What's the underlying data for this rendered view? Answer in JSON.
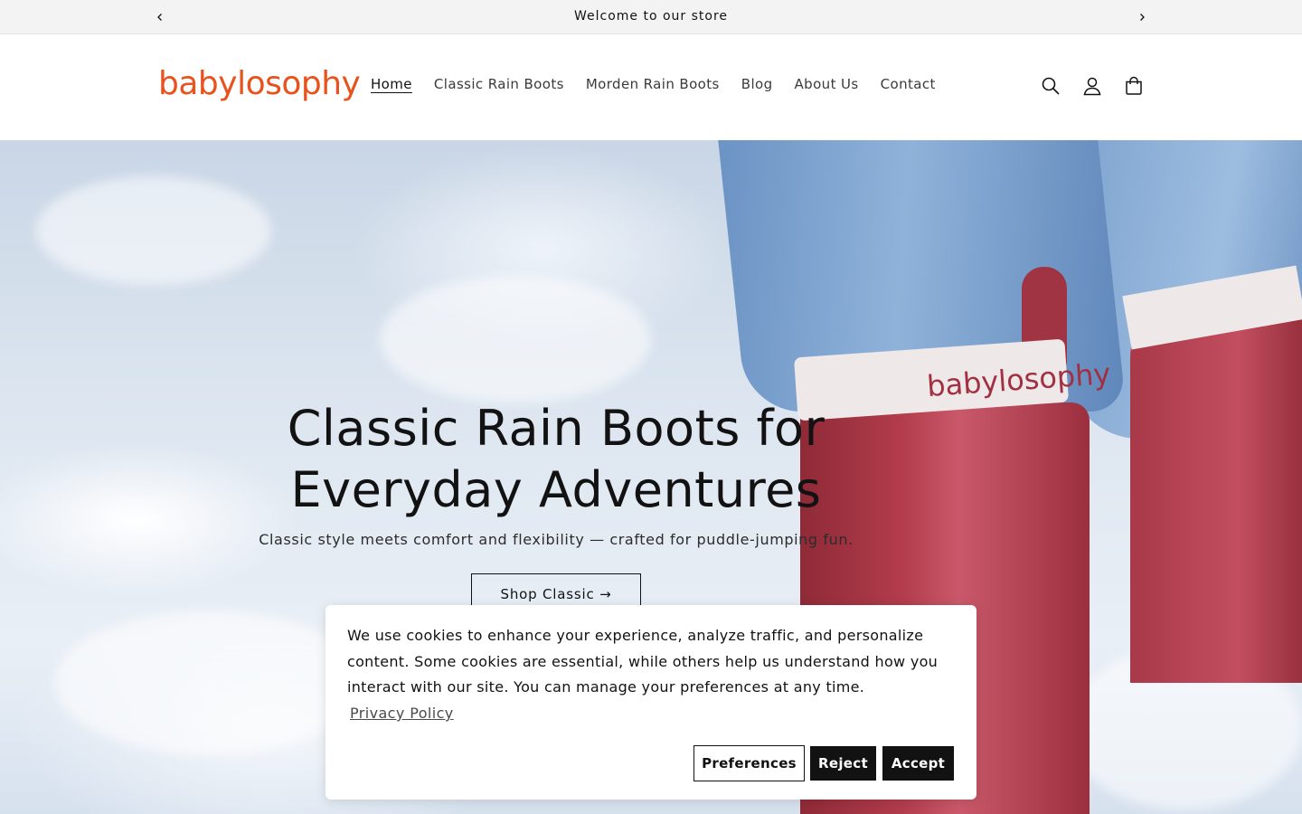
{
  "announcement": {
    "text": "Welcome to our store",
    "prev_icon": "chevron-left-icon",
    "next_icon": "chevron-right-icon"
  },
  "header": {
    "logo_text": "babylosophy",
    "brand_color": "#e8521c",
    "nav": [
      {
        "label": "Home",
        "active": true
      },
      {
        "label": "Classic Rain Boots",
        "active": false
      },
      {
        "label": "Morden Rain Boots",
        "active": false
      },
      {
        "label": "Blog",
        "active": false
      },
      {
        "label": "About Us",
        "active": false
      },
      {
        "label": "Contact",
        "active": false
      }
    ],
    "icons": [
      "search-icon",
      "account-icon",
      "cart-icon"
    ]
  },
  "hero": {
    "boot_brand": "babylosophy",
    "title": "Classic Rain Boots for Everyday Adventures",
    "subtitle": "Classic style meets comfort and flexibility — crafted for puddle-jumping fun.",
    "button_label": "Shop Classic →"
  },
  "cookie_banner": {
    "text": "We use cookies to enhance your experience, analyze traffic, and personalize content. Some cookies are essential, while others help us understand how you interact with our site. You can manage your preferences at any time.",
    "privacy_link": "Privacy Policy",
    "preferences_label": "Preferences",
    "reject_label": "Reject",
    "accept_label": "Accept"
  }
}
